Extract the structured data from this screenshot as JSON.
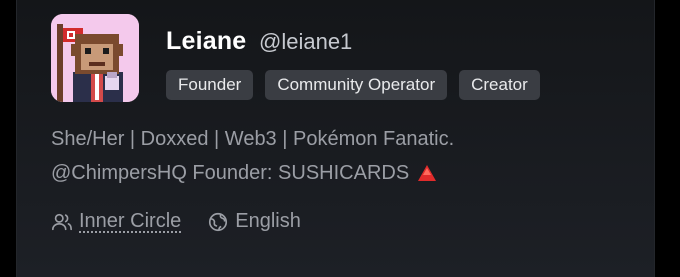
{
  "profile": {
    "name": "Leiane",
    "handle": "@leiane1",
    "avatar_icon": "chimp-avatar-icon",
    "badges": [
      "Founder",
      "Community Operator",
      "Creator"
    ],
    "bio": {
      "line1": "She/Her | Doxxed | Web3 | Pokémon Fanatic.",
      "line2": "@ChimpersHQ Founder: SUSHICARDS"
    },
    "meta": {
      "circle_label": "Inner Circle",
      "language_label": "English"
    }
  },
  "colors": {
    "card_bg": "#1a1c20",
    "badge_bg": "#3a3d43",
    "muted_text": "#9b9ea5",
    "avatar_bg": "#f4c9ec",
    "accent_red": "#e02b2b"
  }
}
